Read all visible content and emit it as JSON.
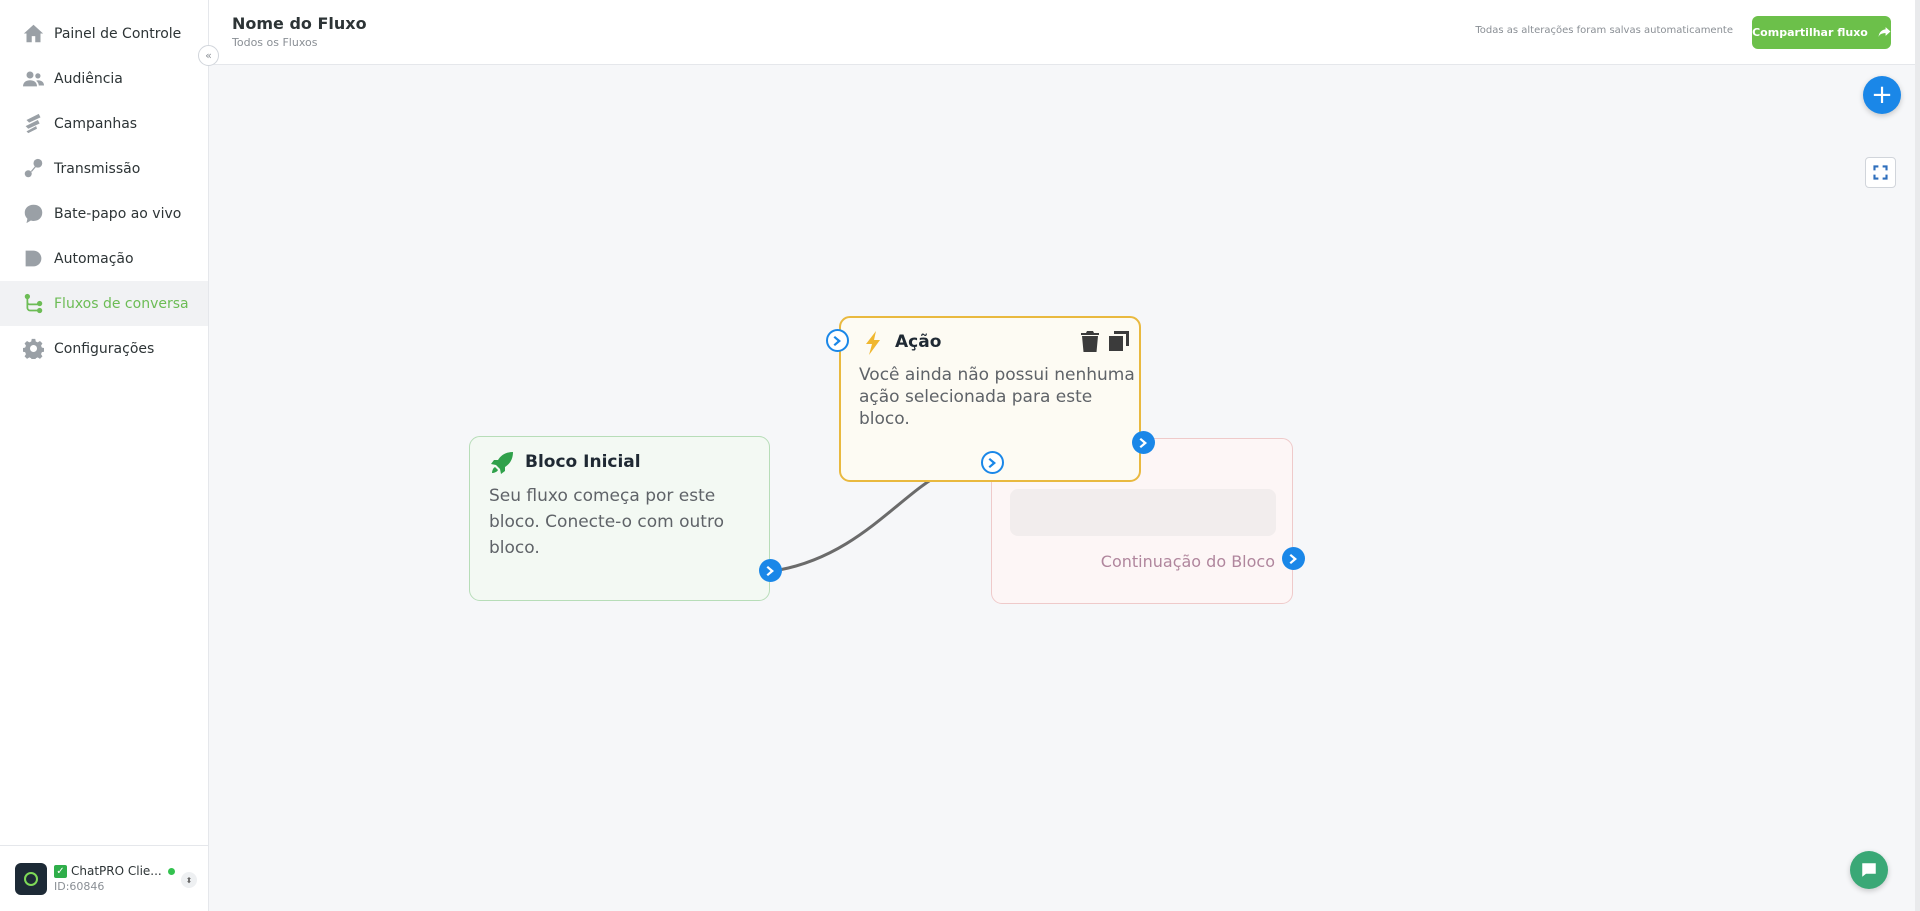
{
  "sidebar": {
    "items": [
      {
        "label": "Painel de Controle",
        "icon": "home-icon",
        "active": false
      },
      {
        "label": "Audiência",
        "icon": "users-icon",
        "active": false
      },
      {
        "label": "Campanhas",
        "icon": "campaign-icon",
        "active": false
      },
      {
        "label": "Transmissão",
        "icon": "broadcast-icon",
        "active": false
      },
      {
        "label": "Bate-papo ao vivo",
        "icon": "chat-bubble-icon",
        "active": false
      },
      {
        "label": "Automação",
        "icon": "automation-icon",
        "active": false
      },
      {
        "label": "Fluxos de conversa",
        "icon": "flow-icon",
        "active": true
      },
      {
        "label": "Configurações",
        "icon": "gear-icon",
        "active": false
      }
    ],
    "collapse_glyph": "«",
    "account": {
      "name": "ChatPRO Clie...",
      "id": "ID:60846",
      "status_color": "#33c24f"
    }
  },
  "header": {
    "title": "Nome do Fluxo",
    "breadcrumb": "Todos os Fluxos",
    "save_status": "Todas as alterações foram salvas automaticamente",
    "share_label": "Compartilhar fluxo"
  },
  "canvas": {
    "add_glyph": "+",
    "blocks": {
      "start": {
        "title": "Bloco Inicial",
        "description": "Seu fluxo começa por este bloco. Conecte-o com outro bloco.",
        "icon": "rocket-icon",
        "border_color": "#b7ddb8"
      },
      "action": {
        "title": "Ação",
        "description": "Você ainda não possui nenhuma ação selecionada para este bloco.",
        "icon": "lightning-icon",
        "border_color": "#e9b93f"
      },
      "continuation": {
        "label": "Continuação do Bloco",
        "border_color": "#efcaca"
      }
    }
  },
  "colors": {
    "accent_green": "#6cc04a",
    "accent_blue": "#1a87e8",
    "active_nav": "#6cbc55"
  }
}
